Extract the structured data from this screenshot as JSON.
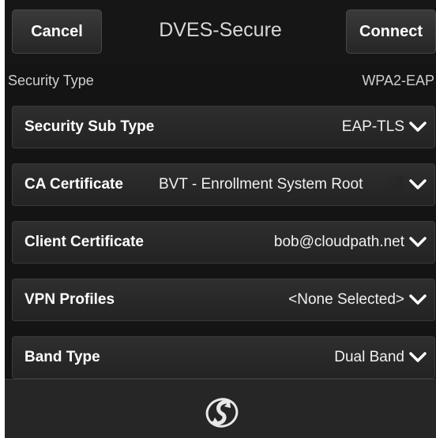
{
  "header": {
    "cancel_label": "Cancel",
    "title": "DVES-Secure",
    "connect_label": "Connect"
  },
  "security_type": {
    "label": "Security Type",
    "value": "WPA2-EAP"
  },
  "rows": [
    {
      "label": "Security Sub Type",
      "value": "EAP-TLS"
    },
    {
      "label": "CA Certificate",
      "value": "BVT - Enrollment System Root"
    },
    {
      "label": "Client Certificate",
      "value": "bob@cloudpath.net"
    },
    {
      "label": "VPN Profiles",
      "value": "<None Selected>"
    },
    {
      "label": "Band Type",
      "value": "Dual Band"
    }
  ],
  "icons": {
    "dropdown": "chevron-down-icon",
    "footer": "app-logo-icon"
  }
}
